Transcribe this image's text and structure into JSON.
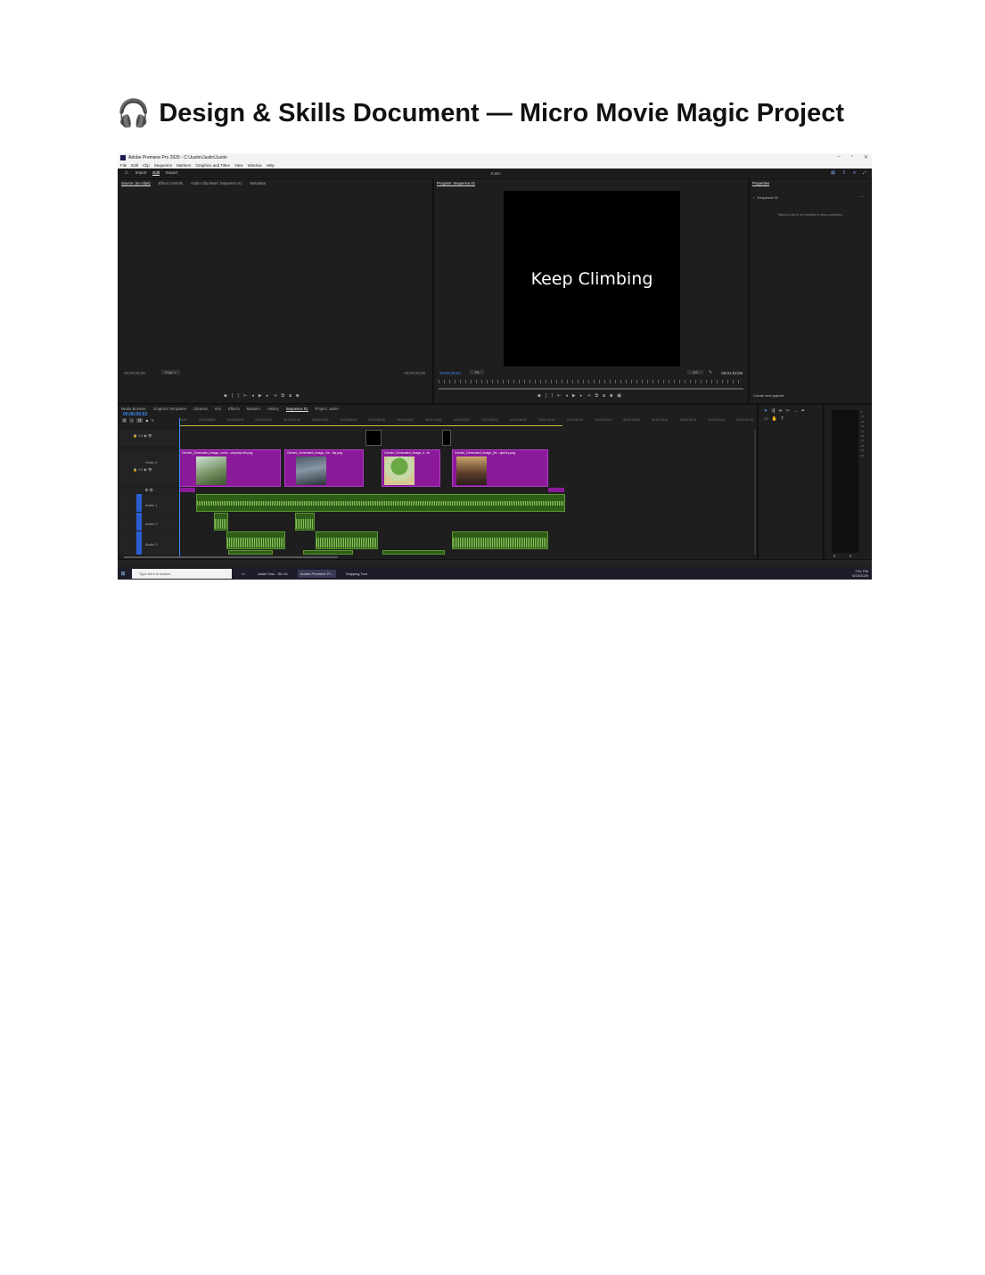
{
  "document": {
    "title_icon": "headphones-icon",
    "title_emoji": "🎧",
    "title": "Design & Skills Document — Micro Movie Magic Project"
  },
  "window": {
    "title": "Adobe Premiere Pro 2025 - C:\\Justin\\Justin\\Justin",
    "menu": [
      "File",
      "Edit",
      "Clip",
      "Sequence",
      "Markers",
      "Graphics and Titles",
      "View",
      "Window",
      "Help"
    ],
    "modes": [
      "Import",
      "Edit",
      "Export"
    ],
    "active_mode": "Edit",
    "project_name": "Justin"
  },
  "source_panel": {
    "tabs": [
      "Source: (no clips)",
      "Effect Controls",
      "Audio Clip Mixer: Sequence 01",
      "Metadata"
    ],
    "timecode_left": "00;00;00;00",
    "page": "Page 1",
    "timecode_right": "00;00;00;00"
  },
  "program_panel": {
    "tab": "Program: Sequence 01",
    "overlay_text": "Keep Climbing",
    "timecode": "00;00;00;03",
    "fit": "Fit",
    "quality": "1/2",
    "duration": "00;01;52;08"
  },
  "properties_panel": {
    "tab": "Properties",
    "sequence": "Sequence 01",
    "hint": "Select a clip in the timeline to view properties.",
    "graphic_button": "Create new graphic"
  },
  "timeline_panel": {
    "tabs": [
      "Media Browser",
      "Graphics Templates",
      "Libraries",
      "Info",
      "Effects",
      "Markers",
      "History",
      "Sequence 01",
      "Project: Justin"
    ],
    "active_tab": "Sequence 01",
    "timecode": "00;00;00;03",
    "ruler": [
      "00;00",
      "00;00;08;00",
      "00;00;16;00",
      "00;00;24;00",
      "00;00;32;00",
      "00;00;40;00",
      "00;00;48;00",
      "00;00;56;00",
      "00;01;04;02",
      "00;01;12;02",
      "00;01;20;02",
      "00;01;28;02",
      "00;01;36;02",
      "00;01;44;02",
      "00;01;52;02",
      "00;02;00;04",
      "00;02;08;04",
      "00;02;16;04",
      "00;02;24;04",
      "00;02;32;04",
      "00;02;40;04"
    ],
    "tracks": {
      "video2": "Video 2",
      "audio1": "Audio 1",
      "audio2": "Audio 2",
      "audio3": "Audio 3"
    },
    "clips": [
      "Gemini_Generated_Image_cmhu...vmjodqvmb.png",
      "Gemini_Generated_Image_t1e...iliq.png",
      "Gemini_Generated_Image_n...fn",
      "Gemini_Generated_Image_j9x...qhrb1y.png"
    ]
  },
  "meters": {
    "scale": [
      "-6",
      "-12",
      "-18",
      "-24",
      "-30",
      "-36",
      "-42",
      "-48",
      "-54",
      "dB"
    ],
    "labels": [
      "S",
      "S"
    ]
  },
  "taskbar": {
    "search_placeholder": "Type here to search",
    "items": [
      "Justin Gao - Sk UX",
      "Adobe Premiere Pr...",
      "Snipping Tool"
    ],
    "time": "7:51 PM",
    "date": "5/15/2025"
  },
  "colors": {
    "video_clip": "#8b1a9a",
    "audio_clip": "#2f5d17",
    "timecode": "#3d8bff",
    "panel_bg": "#1e1e1e"
  }
}
